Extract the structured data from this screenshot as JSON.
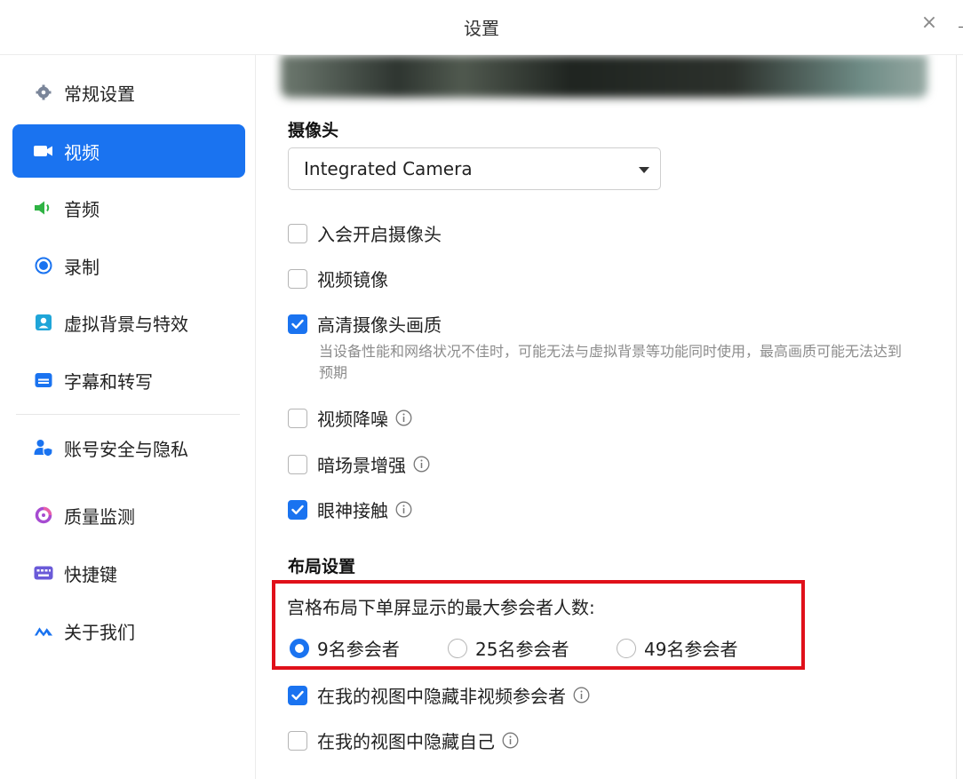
{
  "window": {
    "title": "设置",
    "close_icon": "close-icon",
    "close_glyph": "×"
  },
  "sidebar": {
    "items": [
      {
        "label": "常规设置",
        "icon": "gear-icon",
        "icon_color": "#7a8599"
      },
      {
        "label": "视频",
        "icon": "video-camera-icon",
        "icon_color": "#ffffff",
        "active": true
      },
      {
        "label": "音频",
        "icon": "speaker-icon",
        "icon_color": "#2fb344"
      },
      {
        "label": "录制",
        "icon": "record-icon",
        "icon_color": "#1a73f0"
      },
      {
        "label": "虚拟背景与特效",
        "icon": "person-portrait-icon",
        "icon_color": "#1fa5d8"
      },
      {
        "label": "字幕和转写",
        "icon": "subtitles-icon",
        "icon_color": "#1a73f0"
      },
      {
        "label": "账号安全与隐私",
        "icon": "user-shield-icon",
        "icon_color": "#1a73f0"
      },
      {
        "label": "质量监测",
        "icon": "quality-monitor-icon",
        "icon_color": "#a64bd1"
      },
      {
        "label": "快捷键",
        "icon": "keyboard-icon",
        "icon_color": "#6a5ad8"
      },
      {
        "label": "关于我们",
        "icon": "app-logo-icon",
        "icon_color": "#1a73f0"
      }
    ]
  },
  "camera": {
    "section_title": "摄像头",
    "selected_camera": "Integrated Camera",
    "options": [
      {
        "label": "入会开启摄像头",
        "checked": false,
        "info": false
      },
      {
        "label": "视频镜像",
        "checked": false,
        "info": false
      },
      {
        "label": "高清摄像头画质",
        "checked": true,
        "info": false
      },
      {
        "label": "视频降噪",
        "checked": false,
        "info": true
      },
      {
        "label": "暗场景增强",
        "checked": false,
        "info": true
      },
      {
        "label": "眼神接触",
        "checked": true,
        "info": true
      }
    ],
    "hd_hint": "当设备性能和网络状况不佳时，可能无法与虚拟背景等功能同时使用，最高画质可能无法达到预期"
  },
  "layout": {
    "section_title": "布局设置",
    "grid_label": "宫格布局下单屏显示的最大参会者人数:",
    "radio_options": [
      {
        "label": "9名参会者",
        "selected": true
      },
      {
        "label": "25名参会者",
        "selected": false
      },
      {
        "label": "49名参会者",
        "selected": false
      }
    ],
    "options": [
      {
        "label": "在我的视图中隐藏非视频参会者",
        "checked": true,
        "info": true
      },
      {
        "label": "在我的视图中隐藏自己",
        "checked": false,
        "info": true
      }
    ]
  },
  "colors": {
    "accent": "#1a73f0",
    "highlight_border": "#e0101a",
    "hint_text": "#8c8c8c"
  }
}
